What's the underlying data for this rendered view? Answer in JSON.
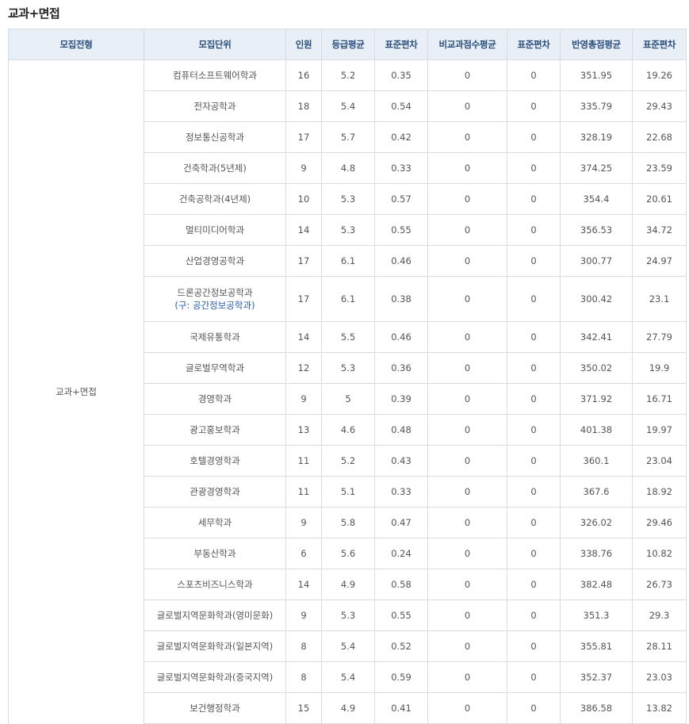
{
  "page_title": "교과+면접",
  "headers": [
    "모집전형",
    "모집단위",
    "인원",
    "등급평균",
    "표준편차",
    "비교과점수평균",
    "표준편차",
    "반영총점평균",
    "표준편차"
  ],
  "group_label": "교과+면접",
  "rows": [
    {
      "unit": "컴퓨터소프트웨어학과",
      "sub": "",
      "count": "16",
      "grade_avg": "5.2",
      "grade_sd": "0.35",
      "nc_avg": "0",
      "nc_sd": "0",
      "total_avg": "351.95",
      "total_sd": "19.26"
    },
    {
      "unit": "전자공학과",
      "sub": "",
      "count": "18",
      "grade_avg": "5.4",
      "grade_sd": "0.54",
      "nc_avg": "0",
      "nc_sd": "0",
      "total_avg": "335.79",
      "total_sd": "29.43"
    },
    {
      "unit": "정보통신공학과",
      "sub": "",
      "count": "17",
      "grade_avg": "5.7",
      "grade_sd": "0.42",
      "nc_avg": "0",
      "nc_sd": "0",
      "total_avg": "328.19",
      "total_sd": "22.68"
    },
    {
      "unit": "건축학과(5년제)",
      "sub": "",
      "count": "9",
      "grade_avg": "4.8",
      "grade_sd": "0.33",
      "nc_avg": "0",
      "nc_sd": "0",
      "total_avg": "374.25",
      "total_sd": "23.59"
    },
    {
      "unit": "건축공학과(4년제)",
      "sub": "",
      "count": "10",
      "grade_avg": "5.3",
      "grade_sd": "0.57",
      "nc_avg": "0",
      "nc_sd": "0",
      "total_avg": "354.4",
      "total_sd": "20.61"
    },
    {
      "unit": "멀티미디어학과",
      "sub": "",
      "count": "14",
      "grade_avg": "5.3",
      "grade_sd": "0.55",
      "nc_avg": "0",
      "nc_sd": "0",
      "total_avg": "356.53",
      "total_sd": "34.72"
    },
    {
      "unit": "산업경영공학과",
      "sub": "",
      "count": "17",
      "grade_avg": "6.1",
      "grade_sd": "0.46",
      "nc_avg": "0",
      "nc_sd": "0",
      "total_avg": "300.77",
      "total_sd": "24.97"
    },
    {
      "unit": "드론공간정보공학과",
      "sub": "(구: 공간정보공학과)",
      "count": "17",
      "grade_avg": "6.1",
      "grade_sd": "0.38",
      "nc_avg": "0",
      "nc_sd": "0",
      "total_avg": "300.42",
      "total_sd": "23.1"
    },
    {
      "unit": "국제유통학과",
      "sub": "",
      "count": "14",
      "grade_avg": "5.5",
      "grade_sd": "0.46",
      "nc_avg": "0",
      "nc_sd": "0",
      "total_avg": "342.41",
      "total_sd": "27.79"
    },
    {
      "unit": "글로벌무역학과",
      "sub": "",
      "count": "12",
      "grade_avg": "5.3",
      "grade_sd": "0.36",
      "nc_avg": "0",
      "nc_sd": "0",
      "total_avg": "350.02",
      "total_sd": "19.9"
    },
    {
      "unit": "경영학과",
      "sub": "",
      "count": "9",
      "grade_avg": "5",
      "grade_sd": "0.39",
      "nc_avg": "0",
      "nc_sd": "0",
      "total_avg": "371.92",
      "total_sd": "16.71"
    },
    {
      "unit": "광고홍보학과",
      "sub": "",
      "count": "13",
      "grade_avg": "4.6",
      "grade_sd": "0.48",
      "nc_avg": "0",
      "nc_sd": "0",
      "total_avg": "401.38",
      "total_sd": "19.97"
    },
    {
      "unit": "호텔경영학과",
      "sub": "",
      "count": "11",
      "grade_avg": "5.2",
      "grade_sd": "0.43",
      "nc_avg": "0",
      "nc_sd": "0",
      "total_avg": "360.1",
      "total_sd": "23.04"
    },
    {
      "unit": "관광경영학과",
      "sub": "",
      "count": "11",
      "grade_avg": "5.1",
      "grade_sd": "0.33",
      "nc_avg": "0",
      "nc_sd": "0",
      "total_avg": "367.6",
      "total_sd": "18.92"
    },
    {
      "unit": "세무학과",
      "sub": "",
      "count": "9",
      "grade_avg": "5.8",
      "grade_sd": "0.47",
      "nc_avg": "0",
      "nc_sd": "0",
      "total_avg": "326.02",
      "total_sd": "29.46"
    },
    {
      "unit": "부동산학과",
      "sub": "",
      "count": "6",
      "grade_avg": "5.6",
      "grade_sd": "0.24",
      "nc_avg": "0",
      "nc_sd": "0",
      "total_avg": "338.76",
      "total_sd": "10.82"
    },
    {
      "unit": "스포츠비즈니스학과",
      "sub": "",
      "count": "14",
      "grade_avg": "4.9",
      "grade_sd": "0.58",
      "nc_avg": "0",
      "nc_sd": "0",
      "total_avg": "382.48",
      "total_sd": "26.73"
    },
    {
      "unit": "글로벌지역문화학과(영미문화)",
      "sub": "",
      "count": "9",
      "grade_avg": "5.3",
      "grade_sd": "0.55",
      "nc_avg": "0",
      "nc_sd": "0",
      "total_avg": "351.3",
      "total_sd": "29.3"
    },
    {
      "unit": "글로벌지역문화학과(일본지역)",
      "sub": "",
      "count": "8",
      "grade_avg": "5.4",
      "grade_sd": "0.52",
      "nc_avg": "0",
      "nc_sd": "0",
      "total_avg": "355.81",
      "total_sd": "28.11"
    },
    {
      "unit": "글로벌지역문화학과(중국지역)",
      "sub": "",
      "count": "8",
      "grade_avg": "5.4",
      "grade_sd": "0.59",
      "nc_avg": "0",
      "nc_sd": "0",
      "total_avg": "352.37",
      "total_sd": "23.03"
    },
    {
      "unit": "보건행정학과",
      "sub": "",
      "count": "15",
      "grade_avg": "4.9",
      "grade_sd": "0.41",
      "nc_avg": "0",
      "nc_sd": "0",
      "total_avg": "386.58",
      "total_sd": "13.82"
    }
  ]
}
